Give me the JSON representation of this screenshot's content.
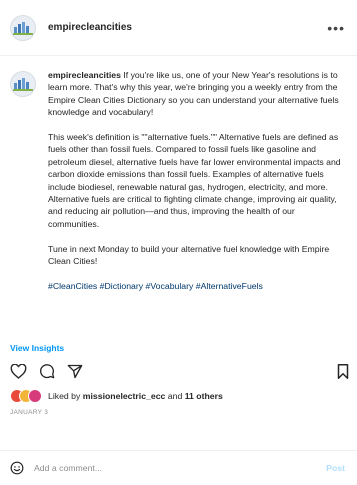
{
  "post": {
    "username": "empirecleancities",
    "more_icon": "more-horizontal-icon"
  },
  "caption": {
    "username": "empirecleancities",
    "paragraphs": [
      "If you're like us, one of your New Year's resolutions is to learn more. That's why this year, we're bringing you a weekly entry from the Empire Clean Cities Dictionary so you can understand your alternative fuels knowledge and vocabulary!",
      "This week's definition is \"\"alternative fuels.\"\" Alternative fuels are defined as fuels other than fossil fuels. Compared to fossil fuels like gasoline and petroleum diesel, alternative fuels have far lower environmental impacts and carbon dioxide emissions than fossil fuels. Examples of alternative fuels include biodiesel, renewable natural gas, hydrogen, electricity, and more. Alternative fuels are critical to fighting climate change, improving air quality, and reducing air pollution—and thus, improving the health of our communities.",
      "Tune in next Monday to build your alternative fuel knowledge with Empire Clean Cities!"
    ],
    "hashtags": "#CleanCities #Dictionary #Vocabulary #AlternativeFuels"
  },
  "insights": {
    "label": "View Insights"
  },
  "actions": {
    "like_icon": "heart-icon",
    "comment_icon": "comment-icon",
    "share_icon": "share-icon",
    "save_icon": "bookmark-icon"
  },
  "likes": {
    "prefix": "Liked by ",
    "user": "missionelectric_ecc",
    "middle": " and ",
    "others": "11 others"
  },
  "date": "JANUARY 3",
  "comment": {
    "placeholder": "Add a comment...",
    "post_label": "Post",
    "emoji_icon": "smiley-icon"
  },
  "colors": {
    "link_blue": "#0095f6",
    "post_disabled": "#b2dffc",
    "hashtag": "#00376b",
    "secondary_text": "#8e8e8e"
  }
}
